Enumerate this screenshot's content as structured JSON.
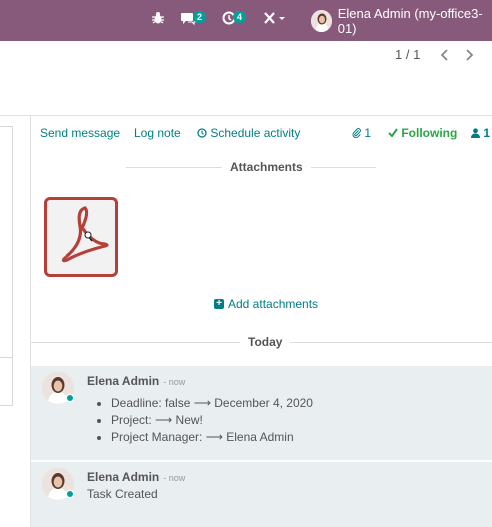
{
  "topbar": {
    "bg_color": "#875a7b",
    "bug_icon": "bug-icon",
    "messages_badge": "2",
    "activities_badge": "4",
    "tools_icon": "tools-icon",
    "user_name": "Elena Admin (my-office3-01)"
  },
  "pager": {
    "value": "1 / 1",
    "prev_icon": "chevron-left-icon",
    "next_icon": "chevron-right-icon"
  },
  "chatter": {
    "send_message": "Send message",
    "log_note": "Log note",
    "schedule_activity": "Schedule activity",
    "attachment_count": "1",
    "following": "Following",
    "follower_count": "1",
    "attachments_label": "Attachments",
    "add_attachments": "Add attachments",
    "today_label": "Today",
    "accent_color": "#017e84"
  },
  "messages": [
    {
      "author": "Elena Admin",
      "when": "- now",
      "tracking": [
        "Deadline: false ⟶ December 4, 2020",
        "Project: ⟶ New!",
        "Project Manager: ⟶ Elena Admin"
      ]
    },
    {
      "author": "Elena Admin",
      "when": "- now",
      "body": "Task Created"
    }
  ]
}
